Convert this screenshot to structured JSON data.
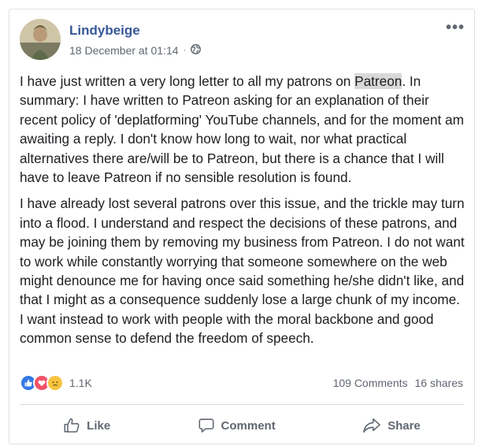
{
  "post": {
    "author": "Lindybeige",
    "timestamp": "18 December at 01:14",
    "separator": "·",
    "privacy_icon": "globe-icon",
    "more_options": "•••",
    "paragraph1": {
      "before": "I have just written a very long letter to all my patrons on ",
      "highlight": "Patreon",
      "after": ". In summary: I have written to Patreon asking for an explanation of their recent policy of 'deplatforming' YouTube channels, and for the moment am awaiting a reply. I don't know how long to wait, nor what practical alternatives there are/will be to Patreon, but there is a chance that I will have to leave Patreon if no sensible resolution is found."
    },
    "paragraph2": "I have already lost several patrons over this issue, and the trickle may turn into a flood. I understand and respect the decisions of these patrons, and may be joining them by removing my business from Patreon. I do not want to work while constantly worrying that someone somewhere on the web might denounce me for having once said something he/she didn't like, and that I might as a consequence suddenly lose a large chunk of my income. I want instead to work with people with the moral backbone and good common sense to defend the freedom of speech."
  },
  "reactions": {
    "types": [
      "like",
      "love",
      "sad"
    ],
    "count": "1.1K"
  },
  "counts": {
    "comments": "109 Comments",
    "shares": "16 shares"
  },
  "actions": {
    "like": "Like",
    "comment": "Comment",
    "share": "Share"
  },
  "colors": {
    "author": "#365899",
    "like": "#3578e5",
    "love": "#f25268",
    "sad": "#f7c33f"
  }
}
